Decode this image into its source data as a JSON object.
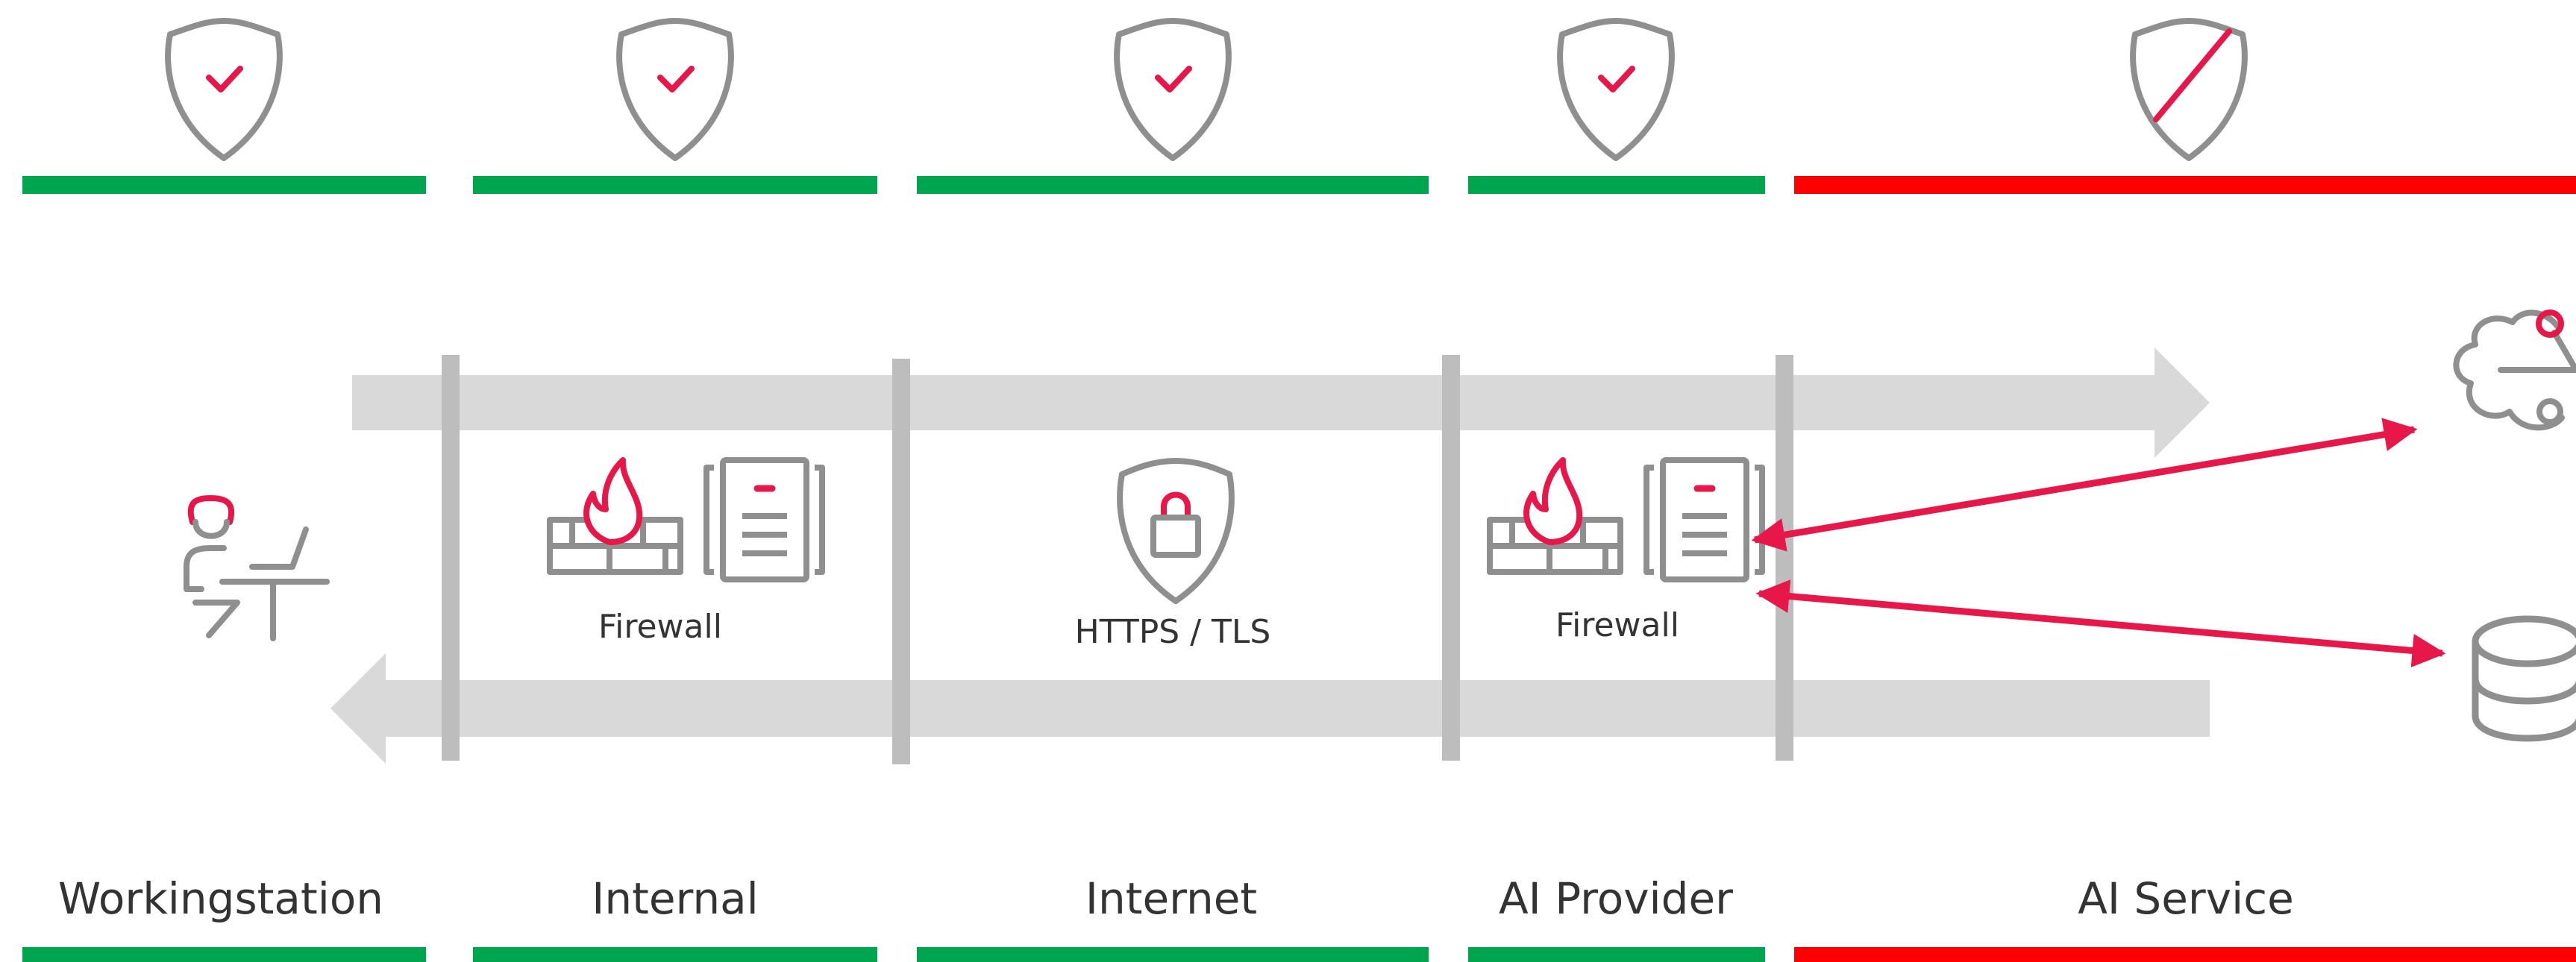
{
  "colors": {
    "secure": "#00a64f",
    "insecure": "#ff0000",
    "accent": "#e8174a",
    "icon_gray": "#8f8f8f",
    "flow_gray": "#d9d9d9",
    "divider_gray": "#bdbdbd",
    "text": "#333333"
  },
  "zones": [
    {
      "label": "Workingstation",
      "status": "secure",
      "shield": "check-icon"
    },
    {
      "label": "Internal",
      "status": "secure",
      "shield": "check-icon"
    },
    {
      "label": "Internet",
      "status": "secure",
      "shield": "check-icon"
    },
    {
      "label": "AI Provider",
      "status": "secure",
      "shield": "check-icon"
    },
    {
      "label": "AI Service",
      "status": "insecure",
      "shield": "slash-icon"
    }
  ],
  "components": {
    "firewall_internal": {
      "label": "Firewall",
      "icon": "firewall-server-icon"
    },
    "https": {
      "label": "HTTPS / TLS",
      "icon": "shield-lock-icon"
    },
    "firewall_provider": {
      "label": "Firewall",
      "icon": "firewall-server-icon"
    }
  },
  "icons": {
    "user": "user-at-desk-icon",
    "cloud": "cloud-network-icon",
    "database": "database-icon"
  }
}
